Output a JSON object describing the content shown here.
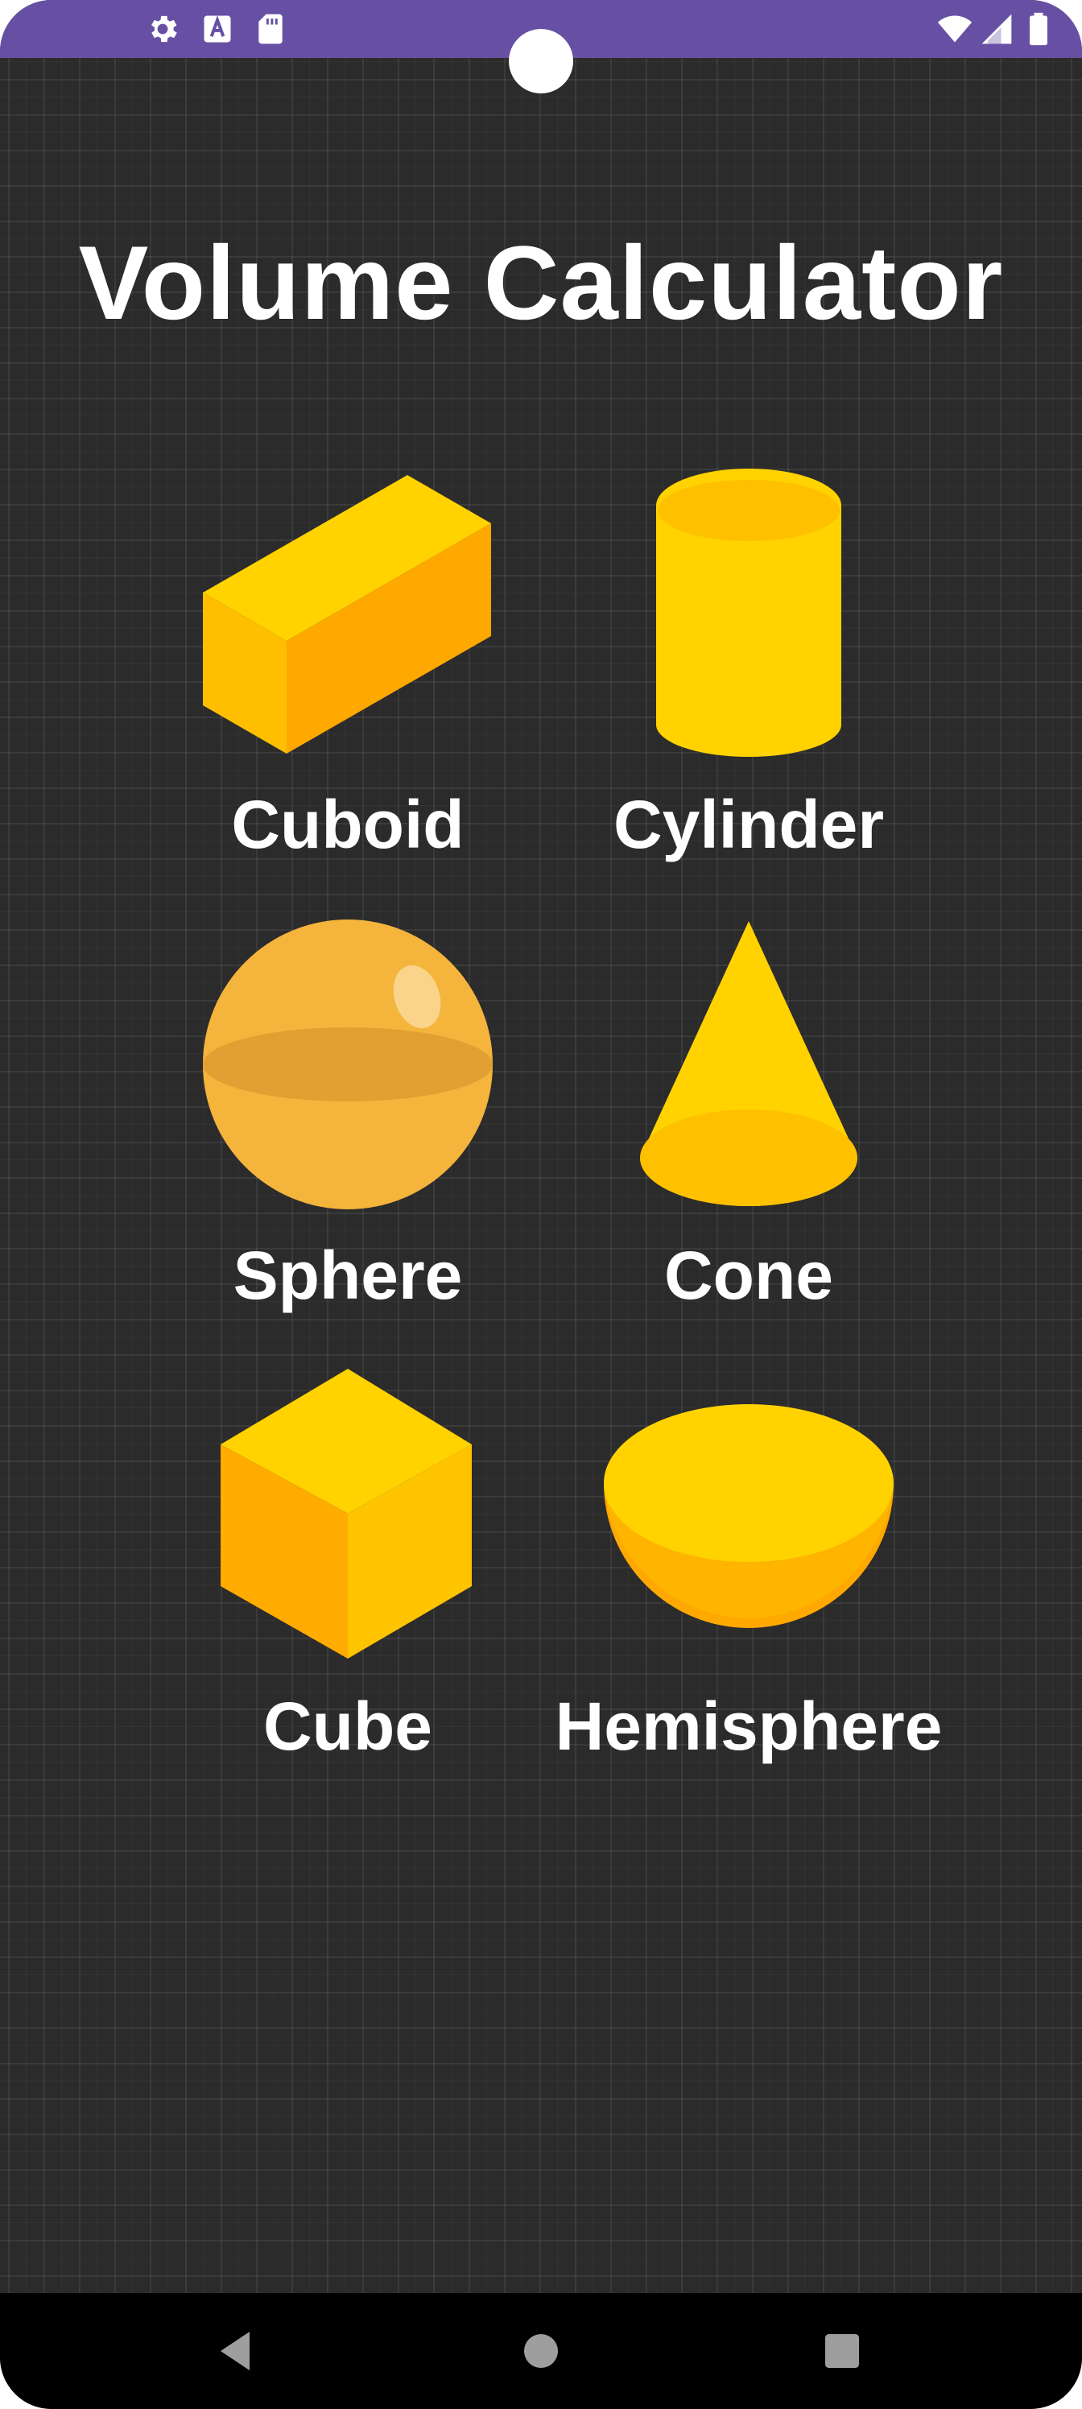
{
  "status_bar": {
    "icons": [
      "gear-icon",
      "text-a-icon",
      "sd-card-icon",
      "wifi-icon",
      "signal-icon",
      "battery-icon"
    ]
  },
  "title": "Volume Calculator",
  "shapes": [
    {
      "label": "Cuboid",
      "icon": "cuboid-icon"
    },
    {
      "label": "Cylinder",
      "icon": "cylinder-icon"
    },
    {
      "label": "Sphere",
      "icon": "sphere-icon"
    },
    {
      "label": "Cone",
      "icon": "cone-icon"
    },
    {
      "label": "Cube",
      "icon": "cube-icon"
    },
    {
      "label": "Hemisphere",
      "icon": "hemisphere-icon"
    }
  ],
  "colors": {
    "status_bar": "#6750a4",
    "background": "#2b2b2b",
    "shape_light": "#ffd200",
    "shape_mid": "#ffbf00",
    "shape_dark": "#ffa800",
    "text": "#ffffff"
  },
  "navigation": {
    "buttons": [
      "back-icon",
      "home-icon",
      "recents-icon"
    ]
  }
}
